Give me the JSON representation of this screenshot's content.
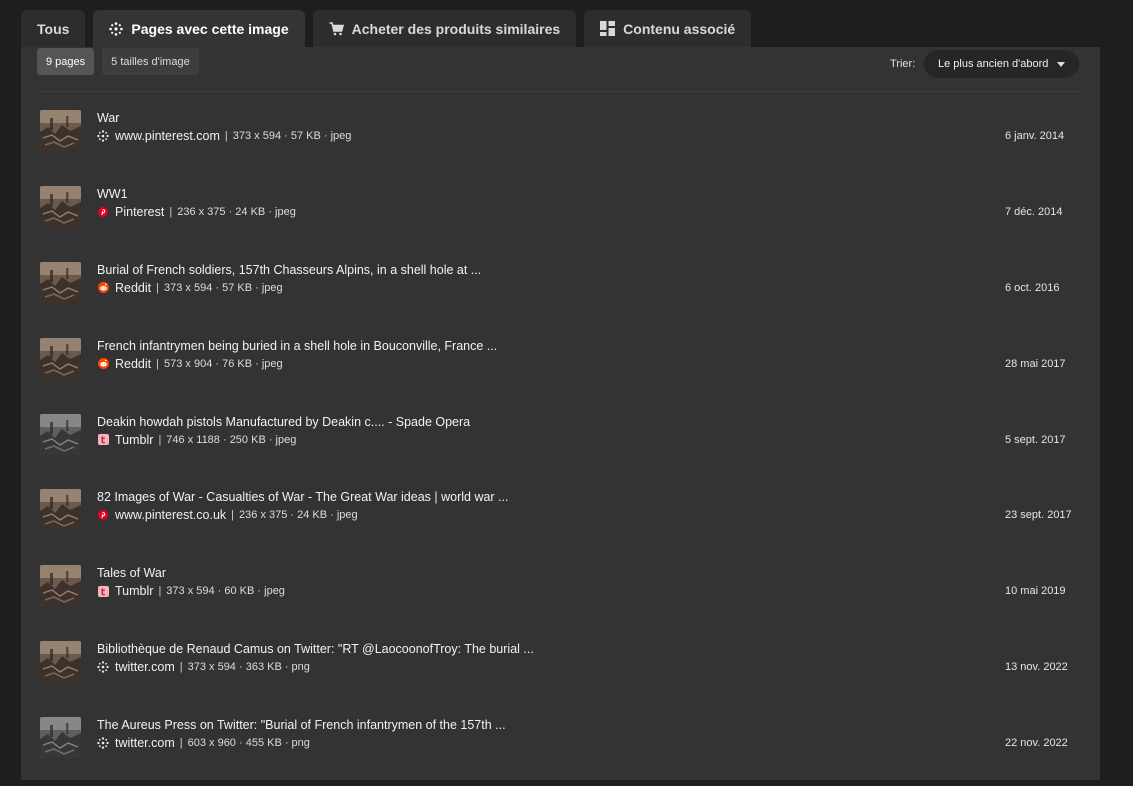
{
  "tabs": [
    {
      "label": "Tous",
      "icon": "none",
      "active": false
    },
    {
      "label": "Pages avec cette image",
      "icon": "globe-icon",
      "active": true
    },
    {
      "label": "Acheter des produits similaires",
      "icon": "cart-icon",
      "active": false
    },
    {
      "label": "Contenu associé",
      "icon": "grid-icon",
      "active": false
    }
  ],
  "filters": {
    "pages": "9 pages",
    "sizes": "5 tailles d'image"
  },
  "sort": {
    "label": "Trier:",
    "value": "Le plus ancien d'abord"
  },
  "colors": {
    "background": "#1e1e1e",
    "panel": "#333333",
    "pinterest": "#e60023",
    "reddit": "#ff4500",
    "tumblr_bg": "#f4b4bf",
    "tumblr_fg": "#c9263f"
  },
  "results": [
    {
      "title": "War",
      "source": "www.pinterest.com",
      "icon": "globe-icon",
      "details": "373 x 594 · 57 KB · jpeg",
      "date": "6 janv. 2014",
      "thumb": "sepia"
    },
    {
      "title": "WW1",
      "source": "Pinterest",
      "icon": "pinterest-icon",
      "details": "236 x 375 · 24 KB · jpeg",
      "date": "7 déc. 2014",
      "thumb": "sepia"
    },
    {
      "title": "Burial of French soldiers, 157th Chasseurs Alpins, in a shell hole at ...",
      "source": "Reddit",
      "icon": "reddit-icon",
      "details": "373 x 594 · 57 KB · jpeg",
      "date": "6 oct. 2016",
      "thumb": "sepia"
    },
    {
      "title": "French infantrymen being buried in a shell hole in Bouconville, France ...",
      "source": "Reddit",
      "icon": "reddit-icon",
      "details": "573 x 904 · 76 KB · jpeg",
      "date": "28 mai 2017",
      "thumb": "sepia"
    },
    {
      "title": "Deakin howdah pistols Manufactured by Deakin c.... - Spade Opera",
      "source": "Tumblr",
      "icon": "tumblr-icon",
      "details": "746 x 1188 · 250 KB · jpeg",
      "date": "5 sept. 2017",
      "thumb": "gray"
    },
    {
      "title": "82 Images of War - Casualties of War - The Great War ideas | world war ...",
      "source": "www.pinterest.co.uk",
      "icon": "pinterest-icon",
      "details": "236 x 375 · 24 KB · jpeg",
      "date": "23 sept. 2017",
      "thumb": "sepia"
    },
    {
      "title": "Tales of War",
      "source": "Tumblr",
      "icon": "tumblr-icon",
      "details": "373 x 594 · 60 KB · jpeg",
      "date": "10 mai 2019",
      "thumb": "sepia"
    },
    {
      "title": "Bibliothèque de Renaud Camus on Twitter: \"RT @LaocoonofTroy: The burial ...",
      "source": "twitter.com",
      "icon": "globe-icon",
      "details": "373 x 594 · 363 KB · png",
      "date": "13 nov. 2022",
      "thumb": "sepia"
    },
    {
      "title": "The Aureus Press on Twitter: \"Burial of French infantrymen of the 157th ...",
      "source": "twitter.com",
      "icon": "globe-icon",
      "details": "603 x 960 · 455 KB · png",
      "date": "22 nov. 2022",
      "thumb": "gray"
    }
  ]
}
